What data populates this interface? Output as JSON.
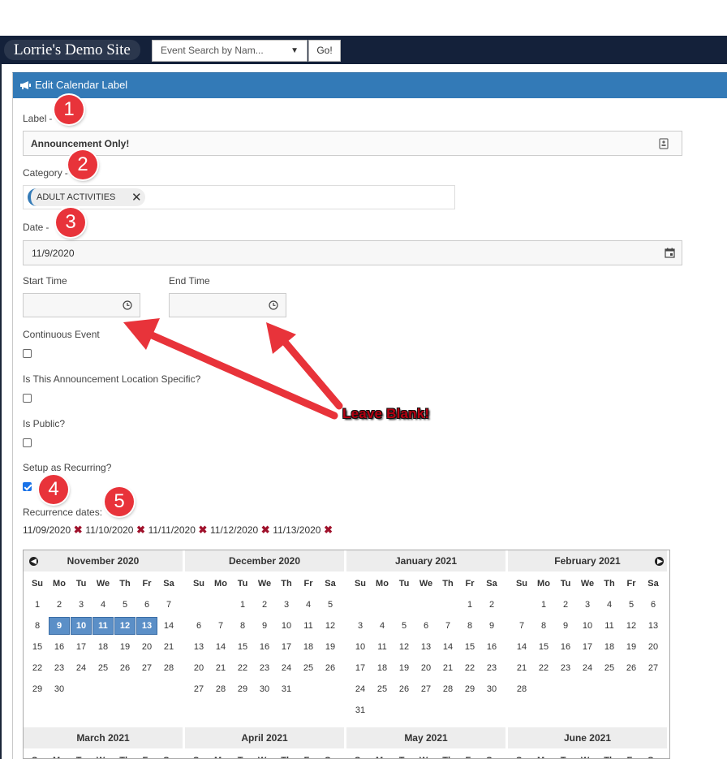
{
  "topbar": {
    "site_title": "Lorrie's Demo Site",
    "search_placeholder": "Event Search by Nam...",
    "go_label": "Go!"
  },
  "panel": {
    "title": "Edit Calendar Label",
    "icon": "bullhorn-icon"
  },
  "form": {
    "label_label": "Label",
    "label_value": "Announcement Only!",
    "category_label": "Category",
    "category_tag": "ADULT ACTIVITIES",
    "date_label": "Date",
    "date_value": "11/9/2020",
    "start_time_label": "Start Time",
    "start_time_value": "",
    "end_time_label": "End Time",
    "end_time_value": "",
    "continuous_label": "Continuous Event",
    "continuous_checked": false,
    "location_label": "Is This Announcement Location Specific?",
    "location_checked": false,
    "public_label": "Is Public?",
    "public_checked": false,
    "recurring_label": "Setup as Recurring?",
    "recurring_checked": true,
    "recurrence_label": "Recurrence dates:",
    "recurrence_dates": [
      "11/09/2020",
      "11/10/2020",
      "11/11/2020",
      "11/12/2020",
      "11/13/2020"
    ],
    "required_marker": "*"
  },
  "calendar": {
    "weekdays": [
      "Su",
      "Mo",
      "Tu",
      "We",
      "Th",
      "Fr",
      "Sa"
    ],
    "months_row1": [
      {
        "name": "November 2020",
        "start": 0,
        "days": 30,
        "selected": [
          9,
          10,
          11,
          12,
          13
        ]
      },
      {
        "name": "December 2020",
        "start": 2,
        "days": 31,
        "selected": []
      },
      {
        "name": "January 2021",
        "start": 5,
        "days": 31,
        "selected": []
      },
      {
        "name": "February 2021",
        "start": 1,
        "days": 28,
        "selected": []
      }
    ],
    "months_row2": [
      "March 2021",
      "April 2021",
      "May 2021",
      "June 2021"
    ]
  },
  "annotations": {
    "badges": [
      "1",
      "2",
      "3",
      "4",
      "5"
    ],
    "callout": "Leave Blank!",
    "badge_color": "#e8333a",
    "arrow_color": "#e8333a"
  },
  "colors": {
    "header_blue": "#337ab7",
    "topbar": "#14213a",
    "tag_accent": "#337ab7",
    "remove_red": "#a0122c",
    "selected_day": "#5b8fc7"
  }
}
